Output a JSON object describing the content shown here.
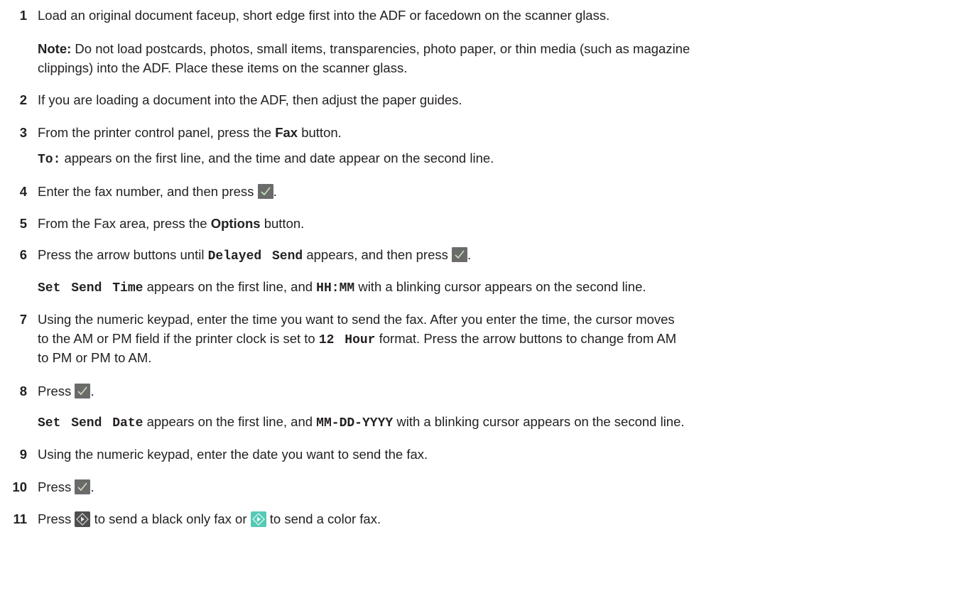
{
  "steps": [
    {
      "num": "1",
      "parts": [
        "Load an original document faceup, short edge first into the ADF or facedown on the scanner glass."
      ]
    },
    {
      "note_label": "Note:",
      "note_line1": "Do not load postcards, photos, small items, transparencies, photo paper, or thin media (such as magazine",
      "note_line2": "clippings) into the ADF. Place these items on the scanner glass."
    },
    {
      "num": "2",
      "text": "If you are loading a document into the ADF, then adjust the paper guides."
    },
    {
      "num": "3",
      "text_before": "From the printer control panel, press the ",
      "bold": "Fax",
      "text_after": " button.",
      "sub_code": "To:",
      "sub_text": " appears on the first line, and the time and date appear on the second line."
    },
    {
      "num": "4",
      "text_before": "Enter the fax number, and then press ",
      "text_after": "."
    },
    {
      "num": "5",
      "text_before": "From the Fax area, press the ",
      "bold": "Options",
      "text_after": " button."
    },
    {
      "num": "6",
      "text_before": "Press the arrow buttons until ",
      "code": "Delayed Send",
      "text_mid": " appears, and then press ",
      "text_after": ".",
      "sub_code1": "Set Send Time",
      "sub_text1": " appears on the first line, and ",
      "sub_code2": "HH:MM",
      "sub_text2": " with a blinking cursor appears on the second line."
    },
    {
      "num": "7",
      "line1": "Using the numeric keypad, enter the time you want to send the fax. After you enter the time, the cursor moves",
      "line2_before": "to the AM or PM field if the printer clock is set to ",
      "line2_code": "12 Hour",
      "line2_after": " format. Press the arrow buttons to change from AM",
      "line3": "to PM or PM to AM."
    },
    {
      "num": "8",
      "text_before": "Press ",
      "text_after": ".",
      "sub_code1": "Set Send Date",
      "sub_text1": " appears on the first line, and ",
      "sub_code2": "MM-DD-YYYY",
      "sub_text2": " with a blinking cursor appears on the second line."
    },
    {
      "num": "9",
      "text": "Using the numeric keypad, enter the date you want to send the fax."
    },
    {
      "num": "10",
      "text_before": "Press ",
      "text_after": "."
    },
    {
      "num": "11",
      "text_before": "Press ",
      "text_mid": " to send a black only fax or ",
      "text_after": " to send a color fax."
    }
  ]
}
